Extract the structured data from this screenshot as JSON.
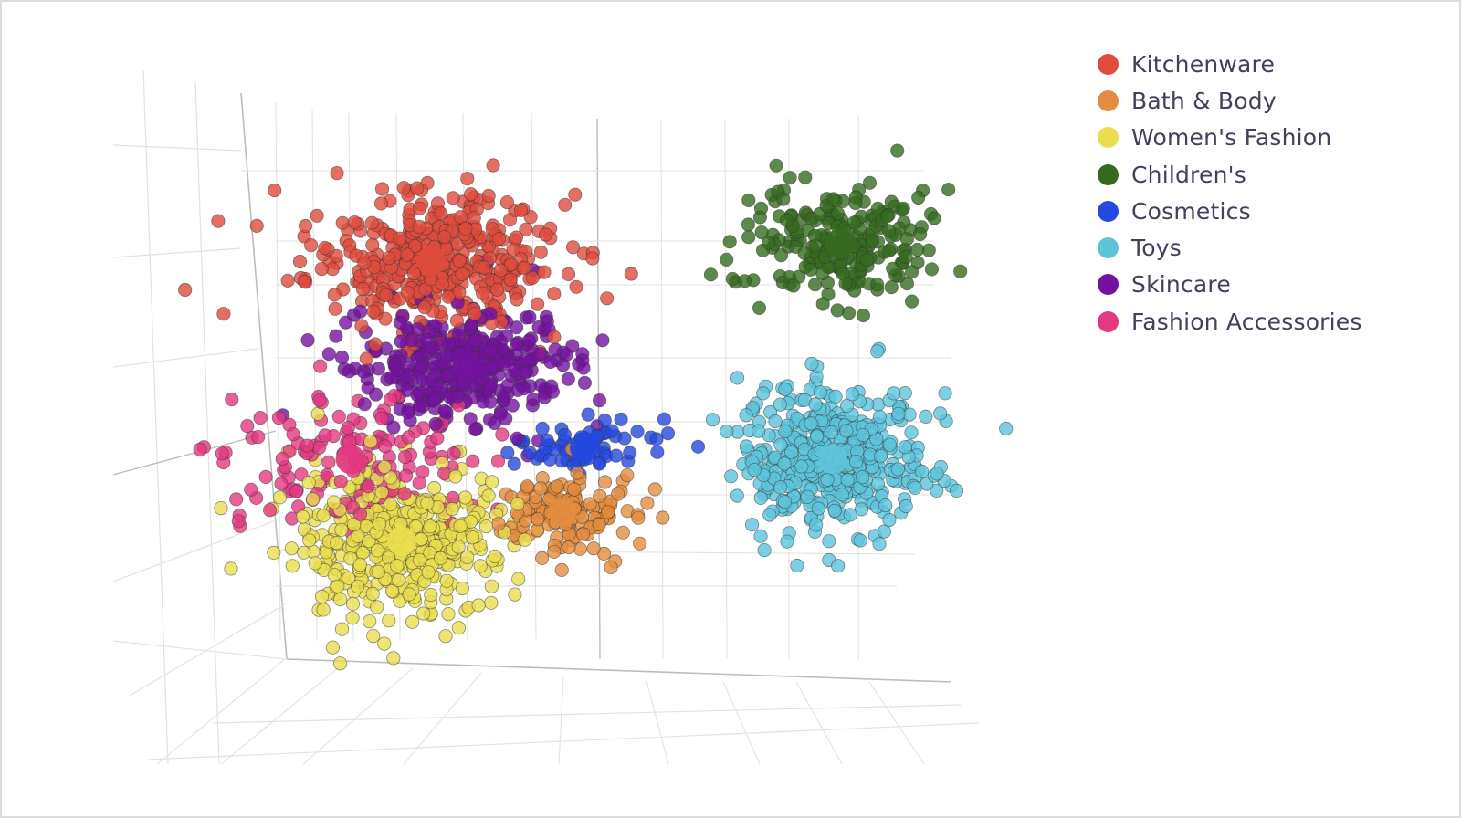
{
  "chart_data": {
    "type": "scatter",
    "dimensions": 3,
    "title": "",
    "xlabel": "",
    "ylabel": "",
    "zlabel": "",
    "grid": true,
    "legend_position": "top-right",
    "xlim": [
      0,
      10
    ],
    "ylim": [
      0,
      10
    ],
    "series": [
      {
        "name": "Kitchenware",
        "color": "#e04b3c",
        "centroid": [
          3.0,
          7.6
        ],
        "spread": [
          1.35,
          0.95
        ],
        "count": 420
      },
      {
        "name": "Bath & Body",
        "color": "#e48c3f",
        "centroid": [
          4.8,
          3.3
        ],
        "spread": [
          0.8,
          0.55
        ],
        "count": 150
      },
      {
        "name": "Women's Fashion",
        "color": "#eadd4f",
        "centroid": [
          2.6,
          2.8
        ],
        "spread": [
          1.2,
          1.0
        ],
        "count": 430
      },
      {
        "name": "Children's",
        "color": "#366b1f",
        "centroid": [
          8.6,
          7.9
        ],
        "spread": [
          0.95,
          0.75
        ],
        "count": 230
      },
      {
        "name": "Cosmetics",
        "color": "#2448e0",
        "centroid": [
          5.1,
          4.4
        ],
        "spread": [
          0.8,
          0.45
        ],
        "count": 70
      },
      {
        "name": "Toys",
        "color": "#5dc4dc",
        "centroid": [
          8.5,
          4.2
        ],
        "spread": [
          1.0,
          1.05
        ],
        "count": 430
      },
      {
        "name": "Skincare",
        "color": "#7412a0",
        "centroid": [
          3.5,
          5.8
        ],
        "spread": [
          1.2,
          0.8
        ],
        "count": 340
      },
      {
        "name": "Fashion Accessories",
        "color": "#e33882",
        "centroid": [
          1.9,
          4.2
        ],
        "spread": [
          1.4,
          1.0
        ],
        "count": 150
      }
    ]
  },
  "legend": {
    "items": [
      {
        "label": "Kitchenware",
        "color": "#e04b3c"
      },
      {
        "label": "Bath & Body",
        "color": "#e48c3f"
      },
      {
        "label": "Women's Fashion",
        "color": "#eadd4f"
      },
      {
        "label": "Children's",
        "color": "#366b1f"
      },
      {
        "label": "Cosmetics",
        "color": "#2448e0"
      },
      {
        "label": "Toys",
        "color": "#5dc4dc"
      },
      {
        "label": "Skincare",
        "color": "#7412a0"
      },
      {
        "label": "Fashion Accessories",
        "color": "#e33882"
      }
    ]
  }
}
